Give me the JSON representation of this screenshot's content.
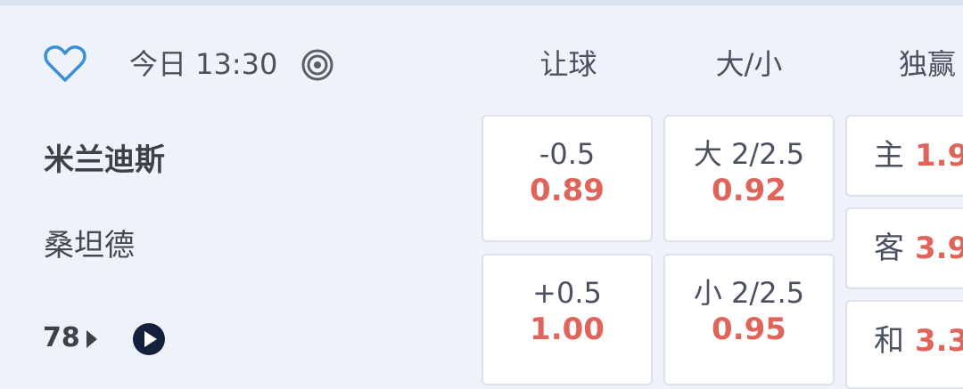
{
  "match": {
    "time": "今日 13:30",
    "home_team": "米兰迪斯",
    "away_team": "桑坦德",
    "more_count": "78"
  },
  "columns": {
    "handicap": "让球",
    "over_under": "大/小",
    "moneyline": "独赢"
  },
  "handicap": {
    "home": {
      "line": "-0.5",
      "price": "0.89"
    },
    "away": {
      "line": "+0.5",
      "price": "1.00"
    }
  },
  "over_under": {
    "over": {
      "line": "大 2/2.5",
      "price": "0.92"
    },
    "under": {
      "line": "小 2/2.5",
      "price": "0.95"
    }
  },
  "moneyline": {
    "home": {
      "label": "主",
      "price": "1.9"
    },
    "away": {
      "label": "客",
      "price": "3.9"
    },
    "draw": {
      "label": "和",
      "price": "3.3"
    }
  },
  "colors": {
    "background": "#eef3fb",
    "accent_blue": "#3a8fd8",
    "odds_red": "#e0645a",
    "navy": "#14213d"
  },
  "icons": {
    "favorite": "heart-outline-icon",
    "live": "target-icon",
    "more": "caret-right-icon",
    "video": "play-circle-icon"
  }
}
